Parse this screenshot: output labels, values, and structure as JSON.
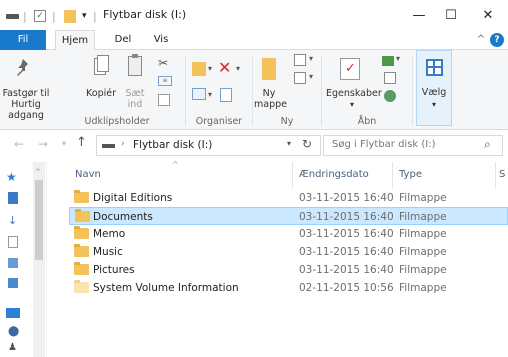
{
  "window": {
    "title": "Flytbar disk (I:)",
    "minimize_glyph": "—",
    "maximize_glyph": "☐",
    "close_glyph": "✕"
  },
  "ribbon_tabs": [
    {
      "label": "Fil"
    },
    {
      "label": "Hjem"
    },
    {
      "label": "Del"
    },
    {
      "label": "Vis"
    }
  ],
  "ribbon": {
    "pin_label_1": "Fastgør til",
    "pin_label_2": "Hurtig adgang",
    "copy_label": "Kopiér",
    "paste_label_1": "Sæt",
    "paste_label_2": "ind",
    "new_folder_label_1": "Ny",
    "new_folder_label_2": "mappe",
    "properties_label": "Egenskaber",
    "select_label": "Vælg",
    "groups": {
      "clipboard": "Udklipsholder",
      "organize": "Organiser",
      "new": "Ny",
      "open": "Åbn"
    }
  },
  "address": {
    "path": "Flytbar disk (I:)",
    "search_placeholder": "Søg i Flytbar disk (I:)"
  },
  "columns": {
    "name": "Navn",
    "date": "Ændringsdato",
    "type": "Type",
    "size": "S"
  },
  "files": [
    {
      "name": "Digital Editions",
      "date": "03-11-2015 16:40",
      "type": "Filmappe"
    },
    {
      "name": "Documents",
      "date": "03-11-2015 16:40",
      "type": "Filmappe"
    },
    {
      "name": "Memo",
      "date": "03-11-2015 16:40",
      "type": "Filmappe"
    },
    {
      "name": "Music",
      "date": "03-11-2015 16:40",
      "type": "Filmappe"
    },
    {
      "name": "Pictures",
      "date": "03-11-2015 16:40",
      "type": "Filmappe"
    },
    {
      "name": "System Volume Information",
      "date": "02-11-2015 10:56",
      "type": "Filmappe"
    }
  ],
  "selected_file": "Documents",
  "colors": {
    "file_tab": "#1979ca",
    "selection": "#cce8ff",
    "folder": "#f3c25a"
  }
}
